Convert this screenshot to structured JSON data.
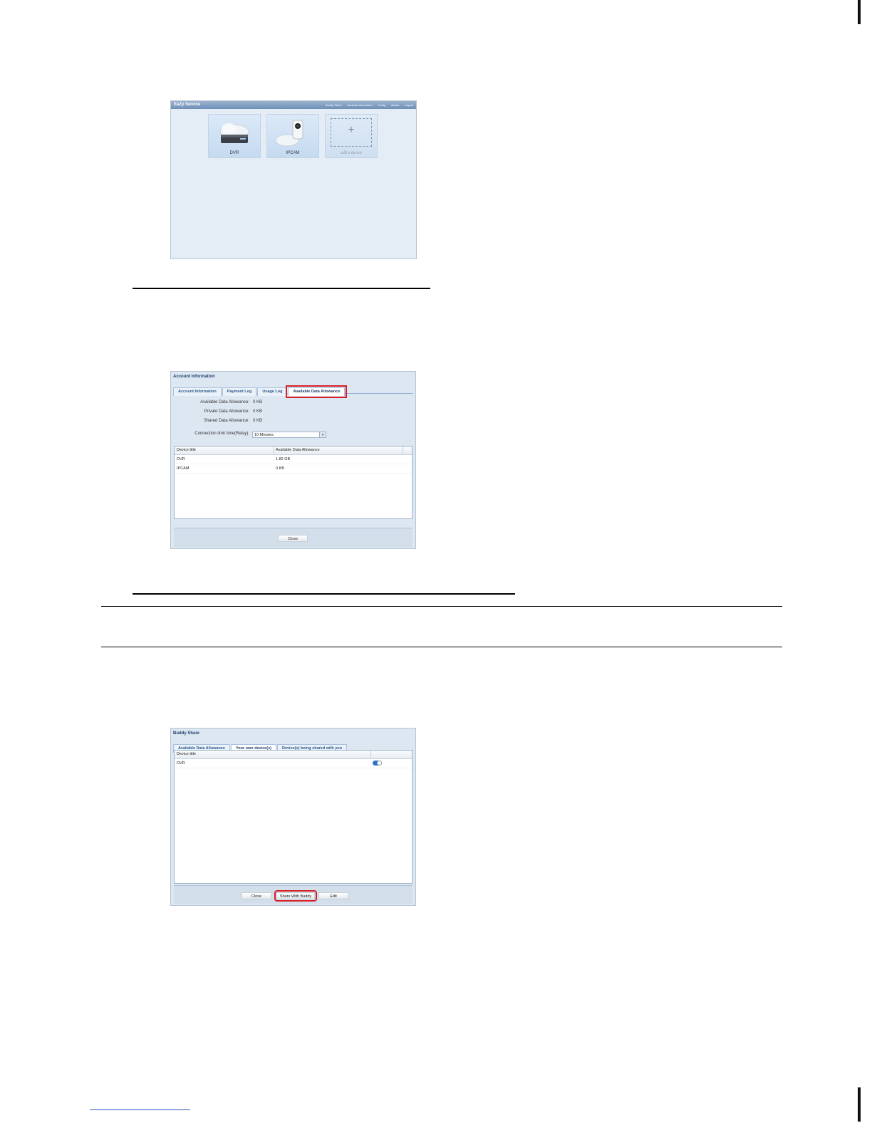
{
  "screenshot_home": {
    "app_title": "EaZy Service",
    "menu": [
      "Buddy Share",
      "Account Information",
      "Config",
      "Viewer",
      "Logout"
    ],
    "tiles": [
      {
        "label": "DVR",
        "icon": "dvr-cloud-icon"
      },
      {
        "label": "IPCAM",
        "icon": "ipcam-cloud-icon"
      },
      {
        "label": "add a device",
        "icon": "plus-icon"
      }
    ]
  },
  "screenshot_account": {
    "title": "Account Information",
    "tabs": [
      "Account Information",
      "Payment Log",
      "Usage Log",
      "Available Data Allowance"
    ],
    "active_tab": "Available Data Allowance",
    "fields": [
      {
        "label": "Available Data Allowance:",
        "value": "0 KB"
      },
      {
        "label": "Private Data Allowance:",
        "value": "0 KB"
      },
      {
        "label": "Shared Data Allowance:",
        "value": "0 KB"
      }
    ],
    "connection_limit": {
      "label": "Connection limit time(Relay):",
      "value": "10 Minutes"
    },
    "table": {
      "headers": [
        "Device title",
        "Available Data Allowance"
      ],
      "rows": [
        [
          "DVR",
          "1.82 GB"
        ],
        [
          "IPCAM",
          "0 KB"
        ]
      ]
    },
    "close_label": "Close"
  },
  "screenshot_buddy": {
    "title": "Buddy Share",
    "tabs": [
      "Available Data Allowance",
      "Your own device(s)",
      "Device(s) being shared with you"
    ],
    "active_tab": "Your own device(s)",
    "table": {
      "headers": [
        "Device title",
        ""
      ],
      "rows": [
        [
          "DVR"
        ]
      ]
    },
    "toggle_on": true,
    "buttons": {
      "close": "Close",
      "share": "Share With Buddy",
      "edit": "Edit"
    }
  },
  "colors": {
    "highlight": "#d71f26",
    "toggle": "#2e74c5",
    "panel": "#dde7f2"
  }
}
